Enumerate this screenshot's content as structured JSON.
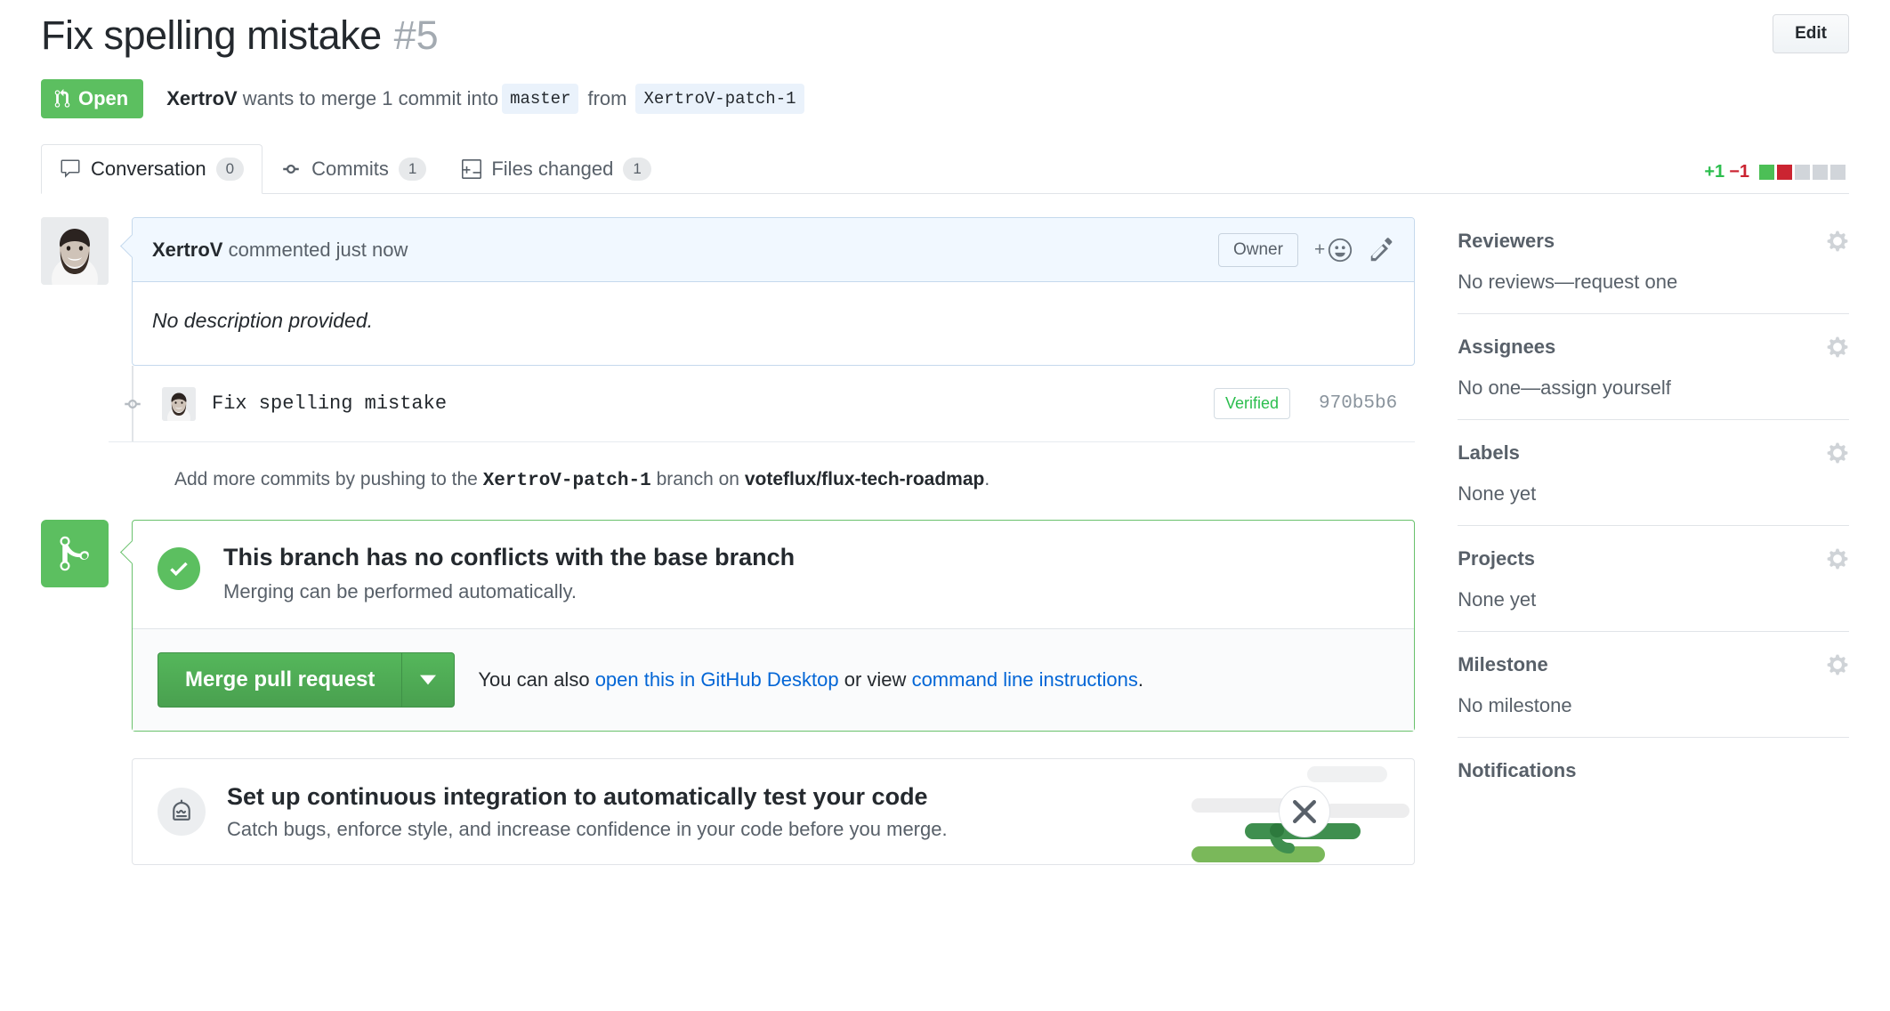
{
  "header": {
    "title": "Fix spelling mistake",
    "number": "#5",
    "edit_label": "Edit",
    "state": "Open",
    "author": "XertroV",
    "merge_phrase": "wants to merge 1 commit into",
    "base_branch": "master",
    "from_word": "from",
    "head_branch": "XertroV-patch-1"
  },
  "tabs": [
    {
      "label": "Conversation",
      "count": "0",
      "icon": "comment-icon",
      "active": true
    },
    {
      "label": "Commits",
      "count": "1",
      "icon": "commit-icon",
      "active": false
    },
    {
      "label": "Files changed",
      "count": "1",
      "icon": "file-diff-icon",
      "active": false
    }
  ],
  "diffstat": {
    "additions": "+1",
    "deletions": "−1",
    "blocks": [
      "g",
      "r",
      "n",
      "n",
      "n"
    ]
  },
  "comment": {
    "author": "XertroV",
    "meta": "commented just now",
    "owner_badge": "Owner",
    "body": "No description provided."
  },
  "commit": {
    "message": "Fix spelling mistake",
    "verified": "Verified",
    "sha": "970b5b6"
  },
  "push_note": {
    "prefix": "Add more commits by pushing to the",
    "branch": "XertroV-patch-1",
    "middle": "branch on",
    "repo": "voteflux/flux-tech-roadmap",
    "suffix": "."
  },
  "merge": {
    "title": "This branch has no conflicts with the base branch",
    "subtitle": "Merging can be performed automatically.",
    "button_label": "Merge pull request",
    "help_prefix": "You can also",
    "help_link1": "open this in GitHub Desktop",
    "help_middle": "or view",
    "help_link2": "command line instructions",
    "help_suffix": "."
  },
  "ci_promo": {
    "title": "Set up continuous integration to automatically test your code",
    "subtitle": "Catch bugs, enforce style, and increase confidence in your code before you merge."
  },
  "sidebar": [
    {
      "title": "Reviewers",
      "value": "No reviews—request one",
      "gear": true
    },
    {
      "title": "Assignees",
      "value": "No one—assign yourself",
      "gear": true
    },
    {
      "title": "Labels",
      "value": "None yet",
      "gear": true
    },
    {
      "title": "Projects",
      "value": "None yet",
      "gear": true
    },
    {
      "title": "Milestone",
      "value": "No milestone",
      "gear": true
    },
    {
      "title": "Notifications",
      "value": "",
      "gear": false
    }
  ],
  "colors": {
    "open_green": "#5cbf60",
    "merge_green": "#49a04f",
    "link_blue": "#0366d6",
    "add_green": "#2cbe4e",
    "del_red": "#cb2431"
  }
}
